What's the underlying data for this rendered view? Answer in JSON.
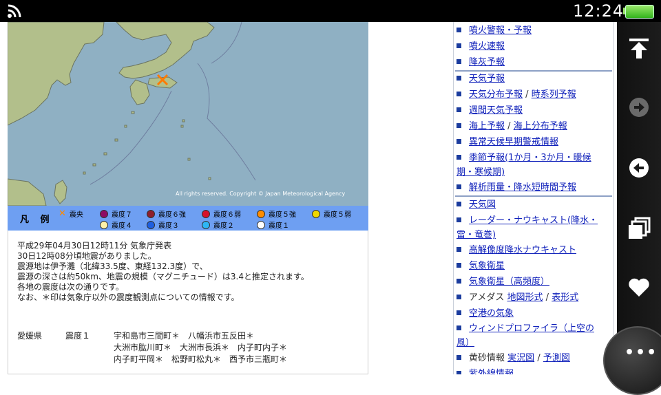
{
  "status": {
    "time": "12:24"
  },
  "map": {
    "copyright": "All rights reserved. Copyright © Japan Meteorological Agency"
  },
  "legend": {
    "title": "凡 例",
    "items": [
      {
        "label": "震央",
        "color": "#ff8a00",
        "symbol": "cross"
      },
      {
        "label": "震度７",
        "color": "#8e0d64"
      },
      {
        "label": "震度６強",
        "color": "#8e1f2c"
      },
      {
        "label": "震度６弱",
        "color": "#d7122b"
      },
      {
        "label": "震度５強",
        "color": "#ff8c00"
      },
      {
        "label": "震度５弱",
        "color": "#f0d800"
      },
      {
        "label": "震度４",
        "color": "#fff2a8"
      },
      {
        "label": "震度３",
        "color": "#1e5fe0"
      },
      {
        "label": "震度２",
        "color": "#2db6f5"
      },
      {
        "label": "震度１",
        "color": "#ffffff"
      }
    ]
  },
  "report": {
    "lines": [
      "平成29年04月30日12時11分 気象庁発表",
      "30日12時08分頃地震がありました。",
      "震源地は伊予灘（北緯33.5度、東経132.3度）で、",
      "震源の深さは約50km、地震の規模（マグニチュード）は3.4と推定されます。",
      "各地の震度は次の通りです。",
      "なお、＊印は気象庁以外の震度観測点についての情報です。"
    ],
    "prefecture": "愛媛県",
    "intensity": "震度１",
    "stations": [
      "宇和島市三間町＊　八幡浜市五反田＊",
      "大洲市肱川町＊　大洲市長浜＊　内子町内子＊",
      "内子町平岡＊　松野町松丸＊　西予市三瓶町＊"
    ]
  },
  "nav": {
    "volcano_warning": "噴火警報・予報",
    "volcano_flash": "噴火速報",
    "ashfall": "降灰予報",
    "weather_forecast": "天気予報",
    "weather_dist": "天気分布予報",
    "slash1": "/",
    "timeseries": "時系列予報",
    "weekly": "週間天気予報",
    "sea": "海上予報",
    "slash2": "/",
    "sea_dist": "海上分布予報",
    "anomalous": "異常天候早期警戒情報",
    "seasonal_line1": "季節予報(1か月・3か月・暖候",
    "seasonal_line2": "期・寒候期)",
    "analyzed_rain": "解析雨量・降水短時間予報",
    "weather_map": "天気図",
    "radar_line1": "レーダー・ナウキャスト(降水・",
    "radar_line2": "雷・竜巻)",
    "hires_nowcast": "高解像度降水ナウキャスト",
    "satellite": "気象衛星",
    "satellite_hf": "気象衛星（高頻度）",
    "amedas": "アメダス",
    "amedas_map": "地図形式",
    "slash3": "/",
    "amedas_table": "表形式",
    "airport": "空港の気象",
    "profiler_line1": "ウィンドプロファイラ（上空の",
    "profiler_line2": "風）",
    "kosa": "黄砂情報",
    "kosa_obs": "実況図",
    "slash4": "/",
    "kosa_fc": "予測図",
    "uv": "紫外線情報"
  }
}
